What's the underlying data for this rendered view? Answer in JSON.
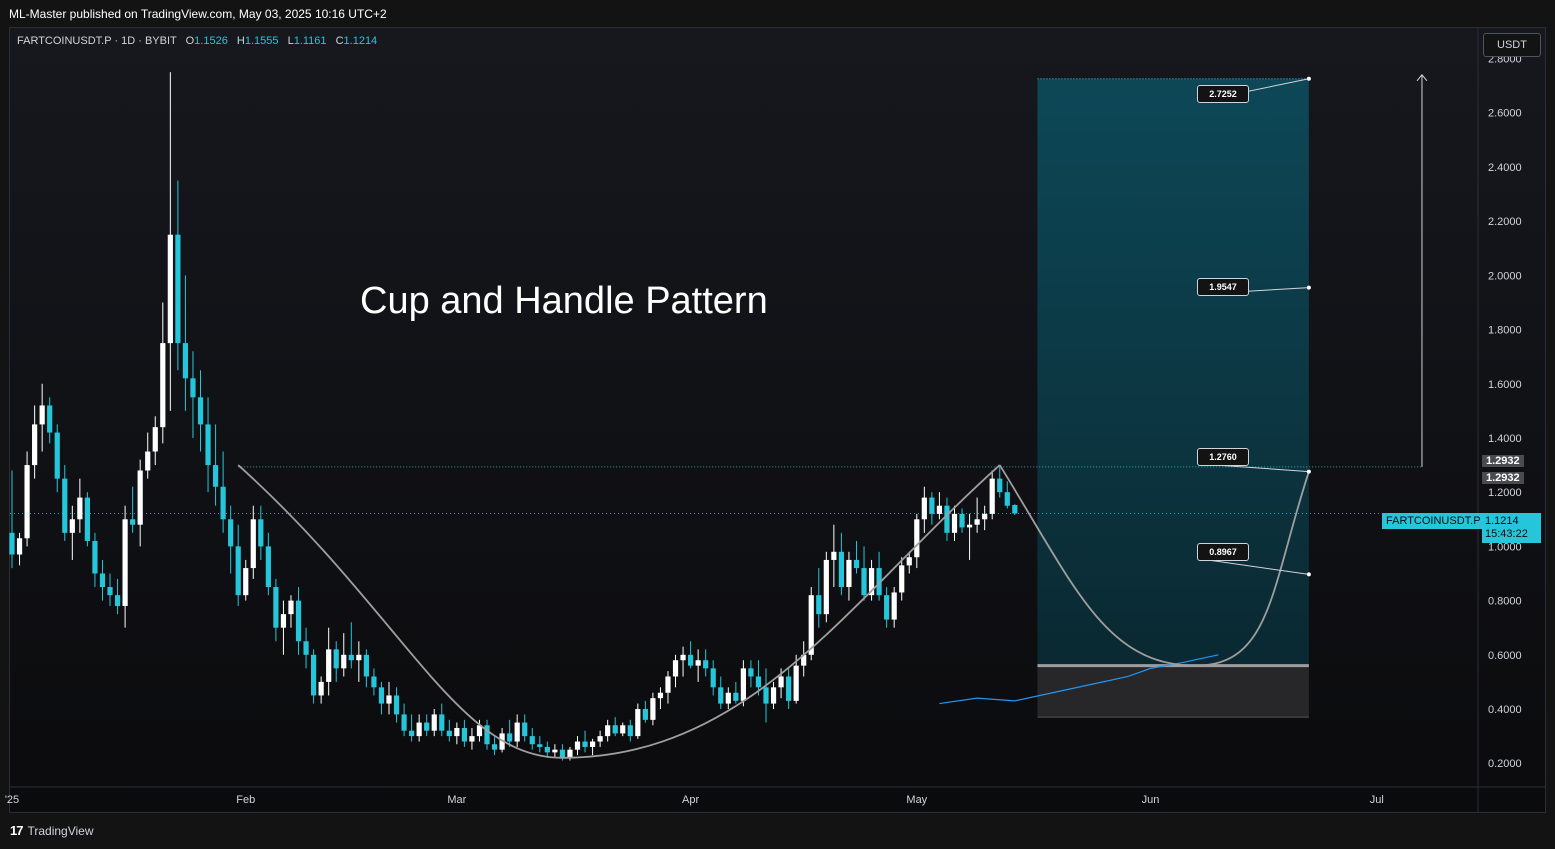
{
  "header": {
    "published": "ML-Master published on TradingView.com, May 03, 2025 10:16 UTC+2"
  },
  "legend": {
    "symbol": "FARTCOINUSDT.P · 1D · BYBIT",
    "o_label": "O",
    "o_value": "1.1526",
    "h_label": "H",
    "h_value": "1.1555",
    "l_label": "L",
    "l_value": "1.1161",
    "c_label": "C",
    "c_value": "1.1214"
  },
  "unit_button": "USDT",
  "annotation": "Cup and Handle Pattern",
  "footer": {
    "logo_mark": "17",
    "logo_text": "TradingView"
  },
  "price_tag": {
    "symbol": "FARTCOINUSDT.P",
    "price": "1.1214",
    "countdown": "15:43:22"
  },
  "resistance_badges": [
    "1.2932",
    "1.2932"
  ],
  "callouts": [
    "2.7252",
    "1.9547",
    "1.2760",
    "0.8967"
  ],
  "colors": {
    "accent": "#26c6da",
    "down": "#26c6da",
    "up": "#ffffff",
    "ma": "#2196f3",
    "zone": "#0d4a5a"
  },
  "chart_data": {
    "type": "candlestick",
    "y_ticks": [
      "0.2000",
      "0.4000",
      "0.6000",
      "0.8000",
      "1.0000",
      "1.2000",
      "1.4000",
      "1.6000",
      "1.8000",
      "2.0000",
      "2.2000",
      "2.4000",
      "2.6000",
      "2.8000"
    ],
    "x_ticks": [
      "'25",
      "Feb",
      "Mar",
      "Apr",
      "May",
      "Jun",
      "Jul"
    ],
    "ylim": [
      0.02,
      2.92
    ],
    "x_start": "2025-01-01",
    "candles": [
      [
        1.05,
        1.28,
        0.92,
        0.97
      ],
      [
        0.97,
        1.05,
        0.93,
        1.03
      ],
      [
        1.03,
        1.35,
        1.0,
        1.3
      ],
      [
        1.3,
        1.52,
        1.25,
        1.45
      ],
      [
        1.45,
        1.6,
        1.35,
        1.52
      ],
      [
        1.52,
        1.55,
        1.38,
        1.42
      ],
      [
        1.42,
        1.45,
        1.2,
        1.25
      ],
      [
        1.25,
        1.3,
        1.02,
        1.05
      ],
      [
        1.05,
        1.15,
        0.95,
        1.1
      ],
      [
        1.1,
        1.25,
        1.05,
        1.18
      ],
      [
        1.18,
        1.2,
        1.0,
        1.02
      ],
      [
        1.02,
        1.05,
        0.85,
        0.9
      ],
      [
        0.9,
        0.95,
        0.8,
        0.85
      ],
      [
        0.85,
        0.9,
        0.78,
        0.82
      ],
      [
        0.82,
        0.88,
        0.75,
        0.78
      ],
      [
        0.78,
        1.15,
        0.7,
        1.1
      ],
      [
        1.1,
        1.22,
        1.05,
        1.08
      ],
      [
        1.08,
        1.32,
        1.0,
        1.28
      ],
      [
        1.28,
        1.42,
        1.25,
        1.35
      ],
      [
        1.35,
        1.48,
        1.3,
        1.44
      ],
      [
        1.44,
        1.9,
        1.38,
        1.75
      ],
      [
        1.75,
        2.75,
        1.5,
        2.15
      ],
      [
        2.15,
        2.35,
        1.65,
        1.75
      ],
      [
        1.75,
        2.0,
        1.5,
        1.62
      ],
      [
        1.62,
        1.72,
        1.4,
        1.55
      ],
      [
        1.55,
        1.65,
        1.35,
        1.45
      ],
      [
        1.45,
        1.55,
        1.2,
        1.3
      ],
      [
        1.3,
        1.45,
        1.15,
        1.22
      ],
      [
        1.22,
        1.35,
        1.05,
        1.1
      ],
      [
        1.1,
        1.15,
        0.9,
        1.0
      ],
      [
        1.0,
        1.08,
        0.78,
        0.82
      ],
      [
        0.82,
        0.95,
        0.8,
        0.92
      ],
      [
        0.92,
        1.15,
        0.88,
        1.1
      ],
      [
        1.1,
        1.15,
        0.95,
        1.0
      ],
      [
        1.0,
        1.05,
        0.82,
        0.85
      ],
      [
        0.85,
        0.88,
        0.65,
        0.7
      ],
      [
        0.7,
        0.8,
        0.6,
        0.75
      ],
      [
        0.75,
        0.82,
        0.7,
        0.8
      ],
      [
        0.8,
        0.85,
        0.6,
        0.65
      ],
      [
        0.65,
        0.7,
        0.55,
        0.6
      ],
      [
        0.6,
        0.62,
        0.42,
        0.45
      ],
      [
        0.45,
        0.52,
        0.42,
        0.5
      ],
      [
        0.5,
        0.7,
        0.45,
        0.62
      ],
      [
        0.62,
        0.65,
        0.5,
        0.55
      ],
      [
        0.55,
        0.68,
        0.52,
        0.6
      ],
      [
        0.6,
        0.72,
        0.55,
        0.58
      ],
      [
        0.58,
        0.65,
        0.5,
        0.6
      ],
      [
        0.6,
        0.62,
        0.48,
        0.52
      ],
      [
        0.52,
        0.55,
        0.45,
        0.48
      ],
      [
        0.48,
        0.5,
        0.38,
        0.42
      ],
      [
        0.42,
        0.5,
        0.38,
        0.45
      ],
      [
        0.45,
        0.48,
        0.35,
        0.38
      ],
      [
        0.38,
        0.42,
        0.3,
        0.32
      ],
      [
        0.32,
        0.38,
        0.28,
        0.3
      ],
      [
        0.3,
        0.38,
        0.28,
        0.35
      ],
      [
        0.35,
        0.38,
        0.3,
        0.32
      ],
      [
        0.32,
        0.4,
        0.3,
        0.38
      ],
      [
        0.38,
        0.42,
        0.3,
        0.32
      ],
      [
        0.32,
        0.36,
        0.28,
        0.3
      ],
      [
        0.3,
        0.35,
        0.27,
        0.33
      ],
      [
        0.33,
        0.36,
        0.26,
        0.28
      ],
      [
        0.28,
        0.33,
        0.25,
        0.3
      ],
      [
        0.3,
        0.36,
        0.28,
        0.34
      ],
      [
        0.34,
        0.36,
        0.25,
        0.27
      ],
      [
        0.27,
        0.3,
        0.23,
        0.25
      ],
      [
        0.25,
        0.33,
        0.24,
        0.31
      ],
      [
        0.31,
        0.36,
        0.26,
        0.28
      ],
      [
        0.28,
        0.38,
        0.26,
        0.35
      ],
      [
        0.35,
        0.38,
        0.28,
        0.3
      ],
      [
        0.3,
        0.33,
        0.25,
        0.27
      ],
      [
        0.27,
        0.3,
        0.24,
        0.26
      ],
      [
        0.26,
        0.28,
        0.22,
        0.24
      ],
      [
        0.24,
        0.27,
        0.22,
        0.25
      ],
      [
        0.25,
        0.27,
        0.21,
        0.22
      ],
      [
        0.22,
        0.26,
        0.21,
        0.25
      ],
      [
        0.25,
        0.3,
        0.23,
        0.28
      ],
      [
        0.28,
        0.32,
        0.24,
        0.26
      ],
      [
        0.26,
        0.29,
        0.23,
        0.28
      ],
      [
        0.28,
        0.32,
        0.26,
        0.3
      ],
      [
        0.3,
        0.36,
        0.28,
        0.34
      ],
      [
        0.34,
        0.37,
        0.3,
        0.31
      ],
      [
        0.31,
        0.35,
        0.3,
        0.34
      ],
      [
        0.34,
        0.36,
        0.28,
        0.3
      ],
      [
        0.3,
        0.42,
        0.29,
        0.4
      ],
      [
        0.4,
        0.43,
        0.35,
        0.36
      ],
      [
        0.36,
        0.46,
        0.34,
        0.44
      ],
      [
        0.44,
        0.48,
        0.4,
        0.46
      ],
      [
        0.46,
        0.54,
        0.42,
        0.52
      ],
      [
        0.52,
        0.6,
        0.48,
        0.58
      ],
      [
        0.58,
        0.63,
        0.52,
        0.6
      ],
      [
        0.6,
        0.65,
        0.55,
        0.56
      ],
      [
        0.56,
        0.62,
        0.5,
        0.58
      ],
      [
        0.58,
        0.62,
        0.52,
        0.55
      ],
      [
        0.55,
        0.58,
        0.45,
        0.48
      ],
      [
        0.48,
        0.52,
        0.4,
        0.42
      ],
      [
        0.42,
        0.48,
        0.4,
        0.46
      ],
      [
        0.46,
        0.5,
        0.42,
        0.43
      ],
      [
        0.43,
        0.58,
        0.41,
        0.55
      ],
      [
        0.55,
        0.58,
        0.48,
        0.52
      ],
      [
        0.52,
        0.58,
        0.45,
        0.48
      ],
      [
        0.48,
        0.55,
        0.35,
        0.42
      ],
      [
        0.42,
        0.5,
        0.4,
        0.48
      ],
      [
        0.48,
        0.55,
        0.44,
        0.52
      ],
      [
        0.52,
        0.55,
        0.4,
        0.43
      ],
      [
        0.43,
        0.6,
        0.42,
        0.56
      ],
      [
        0.56,
        0.65,
        0.52,
        0.6
      ],
      [
        0.6,
        0.85,
        0.58,
        0.82
      ],
      [
        0.82,
        0.92,
        0.7,
        0.75
      ],
      [
        0.75,
        0.98,
        0.72,
        0.95
      ],
      [
        0.95,
        1.08,
        0.85,
        0.98
      ],
      [
        0.98,
        1.05,
        0.82,
        0.85
      ],
      [
        0.85,
        0.98,
        0.8,
        0.95
      ],
      [
        0.95,
        1.02,
        0.9,
        0.92
      ],
      [
        0.92,
        1.0,
        0.8,
        0.82
      ],
      [
        0.82,
        0.95,
        0.8,
        0.92
      ],
      [
        0.92,
        0.98,
        0.8,
        0.82
      ],
      [
        0.82,
        0.85,
        0.7,
        0.73
      ],
      [
        0.73,
        0.85,
        0.7,
        0.83
      ],
      [
        0.83,
        0.96,
        0.8,
        0.93
      ],
      [
        0.93,
        0.98,
        0.9,
        0.96
      ],
      [
        0.96,
        1.12,
        0.92,
        1.1
      ],
      [
        1.1,
        1.22,
        1.05,
        1.18
      ],
      [
        1.18,
        1.2,
        1.08,
        1.12
      ],
      [
        1.12,
        1.2,
        1.1,
        1.15
      ],
      [
        1.15,
        1.18,
        1.02,
        1.05
      ],
      [
        1.05,
        1.15,
        1.02,
        1.12
      ],
      [
        1.12,
        1.14,
        1.05,
        1.07
      ],
      [
        1.07,
        1.12,
        0.95,
        1.08
      ],
      [
        1.08,
        1.18,
        1.05,
        1.1
      ],
      [
        1.1,
        1.15,
        1.06,
        1.12
      ],
      [
        1.12,
        1.28,
        1.1,
        1.25
      ],
      [
        1.25,
        1.3,
        1.18,
        1.2
      ],
      [
        1.2,
        1.24,
        1.14,
        1.15
      ],
      [
        1.1526,
        1.1555,
        1.1161,
        1.1214
      ]
    ],
    "ma": [
      [
        123,
        0.42
      ],
      [
        128,
        0.44
      ],
      [
        133,
        0.43
      ],
      [
        138,
        0.46
      ],
      [
        143,
        0.49
      ],
      [
        148,
        0.52
      ],
      [
        151,
        0.55
      ],
      [
        155,
        0.57
      ],
      [
        160,
        0.6
      ]
    ],
    "cup": {
      "start": [
        30,
        1.3
      ],
      "bottom": [
        73,
        0.22
      ],
      "end": [
        131,
        1.3
      ]
    },
    "handle": {
      "start": [
        131,
        1.3
      ],
      "bottom": [
        157,
        0.56
      ],
      "end": [
        172,
        1.276
      ]
    },
    "resistance": 1.2932,
    "target_zone": {
      "x1": 136,
      "x2": 172,
      "top": 2.7252,
      "bottom": 0.56
    },
    "stop_zone": {
      "x1": 136,
      "x2": 172,
      "top": 0.56,
      "bottom": 0.37
    },
    "projection": {
      "x": 187,
      "from": 1.2932,
      "to": 2.74
    },
    "callout_points": [
      [
        172,
        2.7252
      ],
      [
        172,
        1.9547
      ],
      [
        172,
        1.276
      ],
      [
        172,
        0.8967
      ]
    ],
    "last_price": 1.1214
  }
}
